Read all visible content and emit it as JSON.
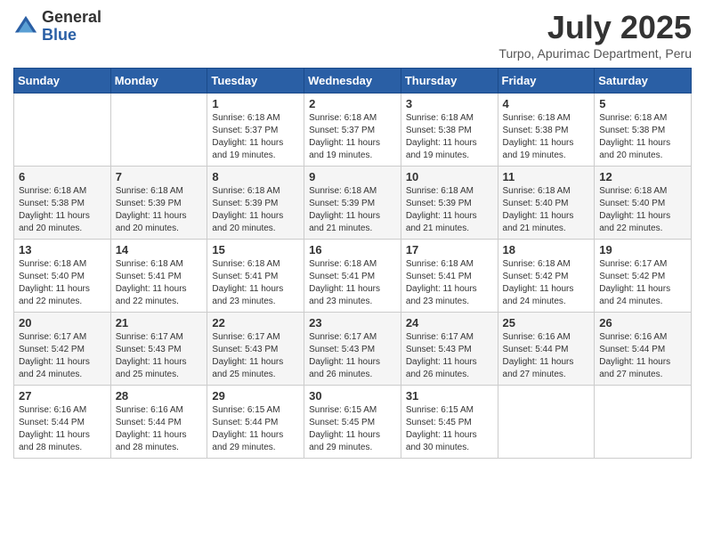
{
  "header": {
    "logo_general": "General",
    "logo_blue": "Blue",
    "month": "July 2025",
    "location": "Turpo, Apurimac Department, Peru"
  },
  "days_of_week": [
    "Sunday",
    "Monday",
    "Tuesday",
    "Wednesday",
    "Thursday",
    "Friday",
    "Saturday"
  ],
  "weeks": [
    [
      {
        "day": "",
        "sunrise": "",
        "sunset": "",
        "daylight": ""
      },
      {
        "day": "",
        "sunrise": "",
        "sunset": "",
        "daylight": ""
      },
      {
        "day": "1",
        "sunrise": "Sunrise: 6:18 AM",
        "sunset": "Sunset: 5:37 PM",
        "daylight": "Daylight: 11 hours and 19 minutes."
      },
      {
        "day": "2",
        "sunrise": "Sunrise: 6:18 AM",
        "sunset": "Sunset: 5:37 PM",
        "daylight": "Daylight: 11 hours and 19 minutes."
      },
      {
        "day": "3",
        "sunrise": "Sunrise: 6:18 AM",
        "sunset": "Sunset: 5:38 PM",
        "daylight": "Daylight: 11 hours and 19 minutes."
      },
      {
        "day": "4",
        "sunrise": "Sunrise: 6:18 AM",
        "sunset": "Sunset: 5:38 PM",
        "daylight": "Daylight: 11 hours and 19 minutes."
      },
      {
        "day": "5",
        "sunrise": "Sunrise: 6:18 AM",
        "sunset": "Sunset: 5:38 PM",
        "daylight": "Daylight: 11 hours and 20 minutes."
      }
    ],
    [
      {
        "day": "6",
        "sunrise": "Sunrise: 6:18 AM",
        "sunset": "Sunset: 5:38 PM",
        "daylight": "Daylight: 11 hours and 20 minutes."
      },
      {
        "day": "7",
        "sunrise": "Sunrise: 6:18 AM",
        "sunset": "Sunset: 5:39 PM",
        "daylight": "Daylight: 11 hours and 20 minutes."
      },
      {
        "day": "8",
        "sunrise": "Sunrise: 6:18 AM",
        "sunset": "Sunset: 5:39 PM",
        "daylight": "Daylight: 11 hours and 20 minutes."
      },
      {
        "day": "9",
        "sunrise": "Sunrise: 6:18 AM",
        "sunset": "Sunset: 5:39 PM",
        "daylight": "Daylight: 11 hours and 21 minutes."
      },
      {
        "day": "10",
        "sunrise": "Sunrise: 6:18 AM",
        "sunset": "Sunset: 5:39 PM",
        "daylight": "Daylight: 11 hours and 21 minutes."
      },
      {
        "day": "11",
        "sunrise": "Sunrise: 6:18 AM",
        "sunset": "Sunset: 5:40 PM",
        "daylight": "Daylight: 11 hours and 21 minutes."
      },
      {
        "day": "12",
        "sunrise": "Sunrise: 6:18 AM",
        "sunset": "Sunset: 5:40 PM",
        "daylight": "Daylight: 11 hours and 22 minutes."
      }
    ],
    [
      {
        "day": "13",
        "sunrise": "Sunrise: 6:18 AM",
        "sunset": "Sunset: 5:40 PM",
        "daylight": "Daylight: 11 hours and 22 minutes."
      },
      {
        "day": "14",
        "sunrise": "Sunrise: 6:18 AM",
        "sunset": "Sunset: 5:41 PM",
        "daylight": "Daylight: 11 hours and 22 minutes."
      },
      {
        "day": "15",
        "sunrise": "Sunrise: 6:18 AM",
        "sunset": "Sunset: 5:41 PM",
        "daylight": "Daylight: 11 hours and 23 minutes."
      },
      {
        "day": "16",
        "sunrise": "Sunrise: 6:18 AM",
        "sunset": "Sunset: 5:41 PM",
        "daylight": "Daylight: 11 hours and 23 minutes."
      },
      {
        "day": "17",
        "sunrise": "Sunrise: 6:18 AM",
        "sunset": "Sunset: 5:41 PM",
        "daylight": "Daylight: 11 hours and 23 minutes."
      },
      {
        "day": "18",
        "sunrise": "Sunrise: 6:18 AM",
        "sunset": "Sunset: 5:42 PM",
        "daylight": "Daylight: 11 hours and 24 minutes."
      },
      {
        "day": "19",
        "sunrise": "Sunrise: 6:17 AM",
        "sunset": "Sunset: 5:42 PM",
        "daylight": "Daylight: 11 hours and 24 minutes."
      }
    ],
    [
      {
        "day": "20",
        "sunrise": "Sunrise: 6:17 AM",
        "sunset": "Sunset: 5:42 PM",
        "daylight": "Daylight: 11 hours and 24 minutes."
      },
      {
        "day": "21",
        "sunrise": "Sunrise: 6:17 AM",
        "sunset": "Sunset: 5:43 PM",
        "daylight": "Daylight: 11 hours and 25 minutes."
      },
      {
        "day": "22",
        "sunrise": "Sunrise: 6:17 AM",
        "sunset": "Sunset: 5:43 PM",
        "daylight": "Daylight: 11 hours and 25 minutes."
      },
      {
        "day": "23",
        "sunrise": "Sunrise: 6:17 AM",
        "sunset": "Sunset: 5:43 PM",
        "daylight": "Daylight: 11 hours and 26 minutes."
      },
      {
        "day": "24",
        "sunrise": "Sunrise: 6:17 AM",
        "sunset": "Sunset: 5:43 PM",
        "daylight": "Daylight: 11 hours and 26 minutes."
      },
      {
        "day": "25",
        "sunrise": "Sunrise: 6:16 AM",
        "sunset": "Sunset: 5:44 PM",
        "daylight": "Daylight: 11 hours and 27 minutes."
      },
      {
        "day": "26",
        "sunrise": "Sunrise: 6:16 AM",
        "sunset": "Sunset: 5:44 PM",
        "daylight": "Daylight: 11 hours and 27 minutes."
      }
    ],
    [
      {
        "day": "27",
        "sunrise": "Sunrise: 6:16 AM",
        "sunset": "Sunset: 5:44 PM",
        "daylight": "Daylight: 11 hours and 28 minutes."
      },
      {
        "day": "28",
        "sunrise": "Sunrise: 6:16 AM",
        "sunset": "Sunset: 5:44 PM",
        "daylight": "Daylight: 11 hours and 28 minutes."
      },
      {
        "day": "29",
        "sunrise": "Sunrise: 6:15 AM",
        "sunset": "Sunset: 5:44 PM",
        "daylight": "Daylight: 11 hours and 29 minutes."
      },
      {
        "day": "30",
        "sunrise": "Sunrise: 6:15 AM",
        "sunset": "Sunset: 5:45 PM",
        "daylight": "Daylight: 11 hours and 29 minutes."
      },
      {
        "day": "31",
        "sunrise": "Sunrise: 6:15 AM",
        "sunset": "Sunset: 5:45 PM",
        "daylight": "Daylight: 11 hours and 30 minutes."
      },
      {
        "day": "",
        "sunrise": "",
        "sunset": "",
        "daylight": ""
      },
      {
        "day": "",
        "sunrise": "",
        "sunset": "",
        "daylight": ""
      }
    ]
  ]
}
